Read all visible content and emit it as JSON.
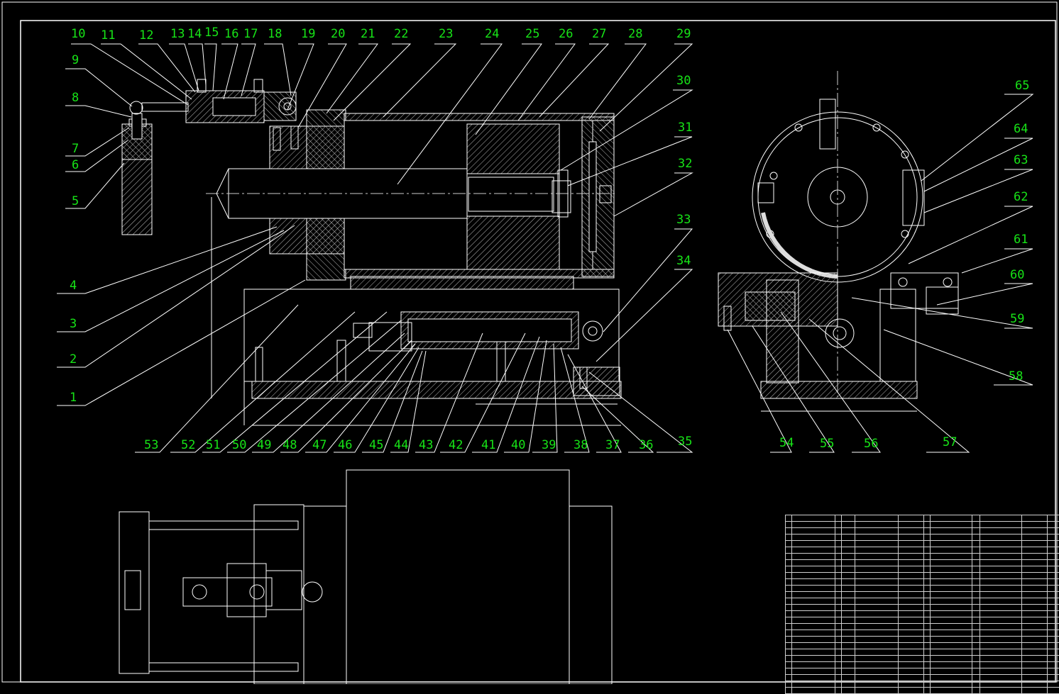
{
  "labels": {
    "n1": "1",
    "n2": "2",
    "n3": "3",
    "n4": "4",
    "n5": "5",
    "n6": "6",
    "n7": "7",
    "n8": "8",
    "n9": "9",
    "n10": "10",
    "n11": "11",
    "n12": "12",
    "n13": "13",
    "n14": "14",
    "n15": "15",
    "n16": "16",
    "n17": "17",
    "n18": "18",
    "n19": "19",
    "n20": "20",
    "n21": "21",
    "n22": "22",
    "n23": "23",
    "n24": "24",
    "n25": "25",
    "n26": "26",
    "n27": "27",
    "n28": "28",
    "n29": "29",
    "n30": "30",
    "n31": "31",
    "n32": "32",
    "n33": "33",
    "n34": "34",
    "n35": "35",
    "n36": "36",
    "n37": "37",
    "n38": "38",
    "n39": "39",
    "n40": "40",
    "n41": "41",
    "n42": "42",
    "n43": "43",
    "n44": "44",
    "n45": "45",
    "n46": "46",
    "n47": "47",
    "n48": "48",
    "n49": "49",
    "n50": "50",
    "n51": "51",
    "n52": "52",
    "n53": "53",
    "n54": "54",
    "n55": "55",
    "n56": "56",
    "n57": "57",
    "n58": "58",
    "n59": "59",
    "n60": "60",
    "n61": "61",
    "n62": "62",
    "n63": "63",
    "n64": "64",
    "n65": "65"
  },
  "colors": {
    "background": "#000000",
    "outline": "#ffffff",
    "label": "#17e317",
    "leader": "#ffffff"
  },
  "title_block": {
    "rows": 28,
    "columns": 12
  }
}
